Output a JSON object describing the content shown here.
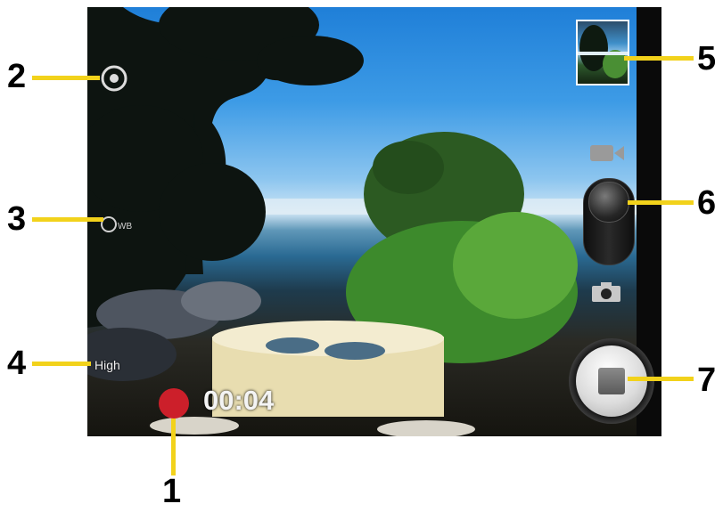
{
  "screen": {
    "record_timer": "00:04",
    "video_quality": "High",
    "icons": {
      "settings": "settings-icon",
      "white_balance": "white-balance-icon",
      "recording_indicator": "recording-indicator-icon",
      "video_mode": "video-camera-icon",
      "photo_mode": "camera-icon",
      "stop": "stop-icon",
      "thumbnail": "gallery-thumbnail"
    },
    "colors": {
      "record_red": "#cc1f2a",
      "callout_yellow": "#f2d21b"
    }
  },
  "callouts": [
    "1",
    "2",
    "3",
    "4",
    "5",
    "6",
    "7"
  ]
}
